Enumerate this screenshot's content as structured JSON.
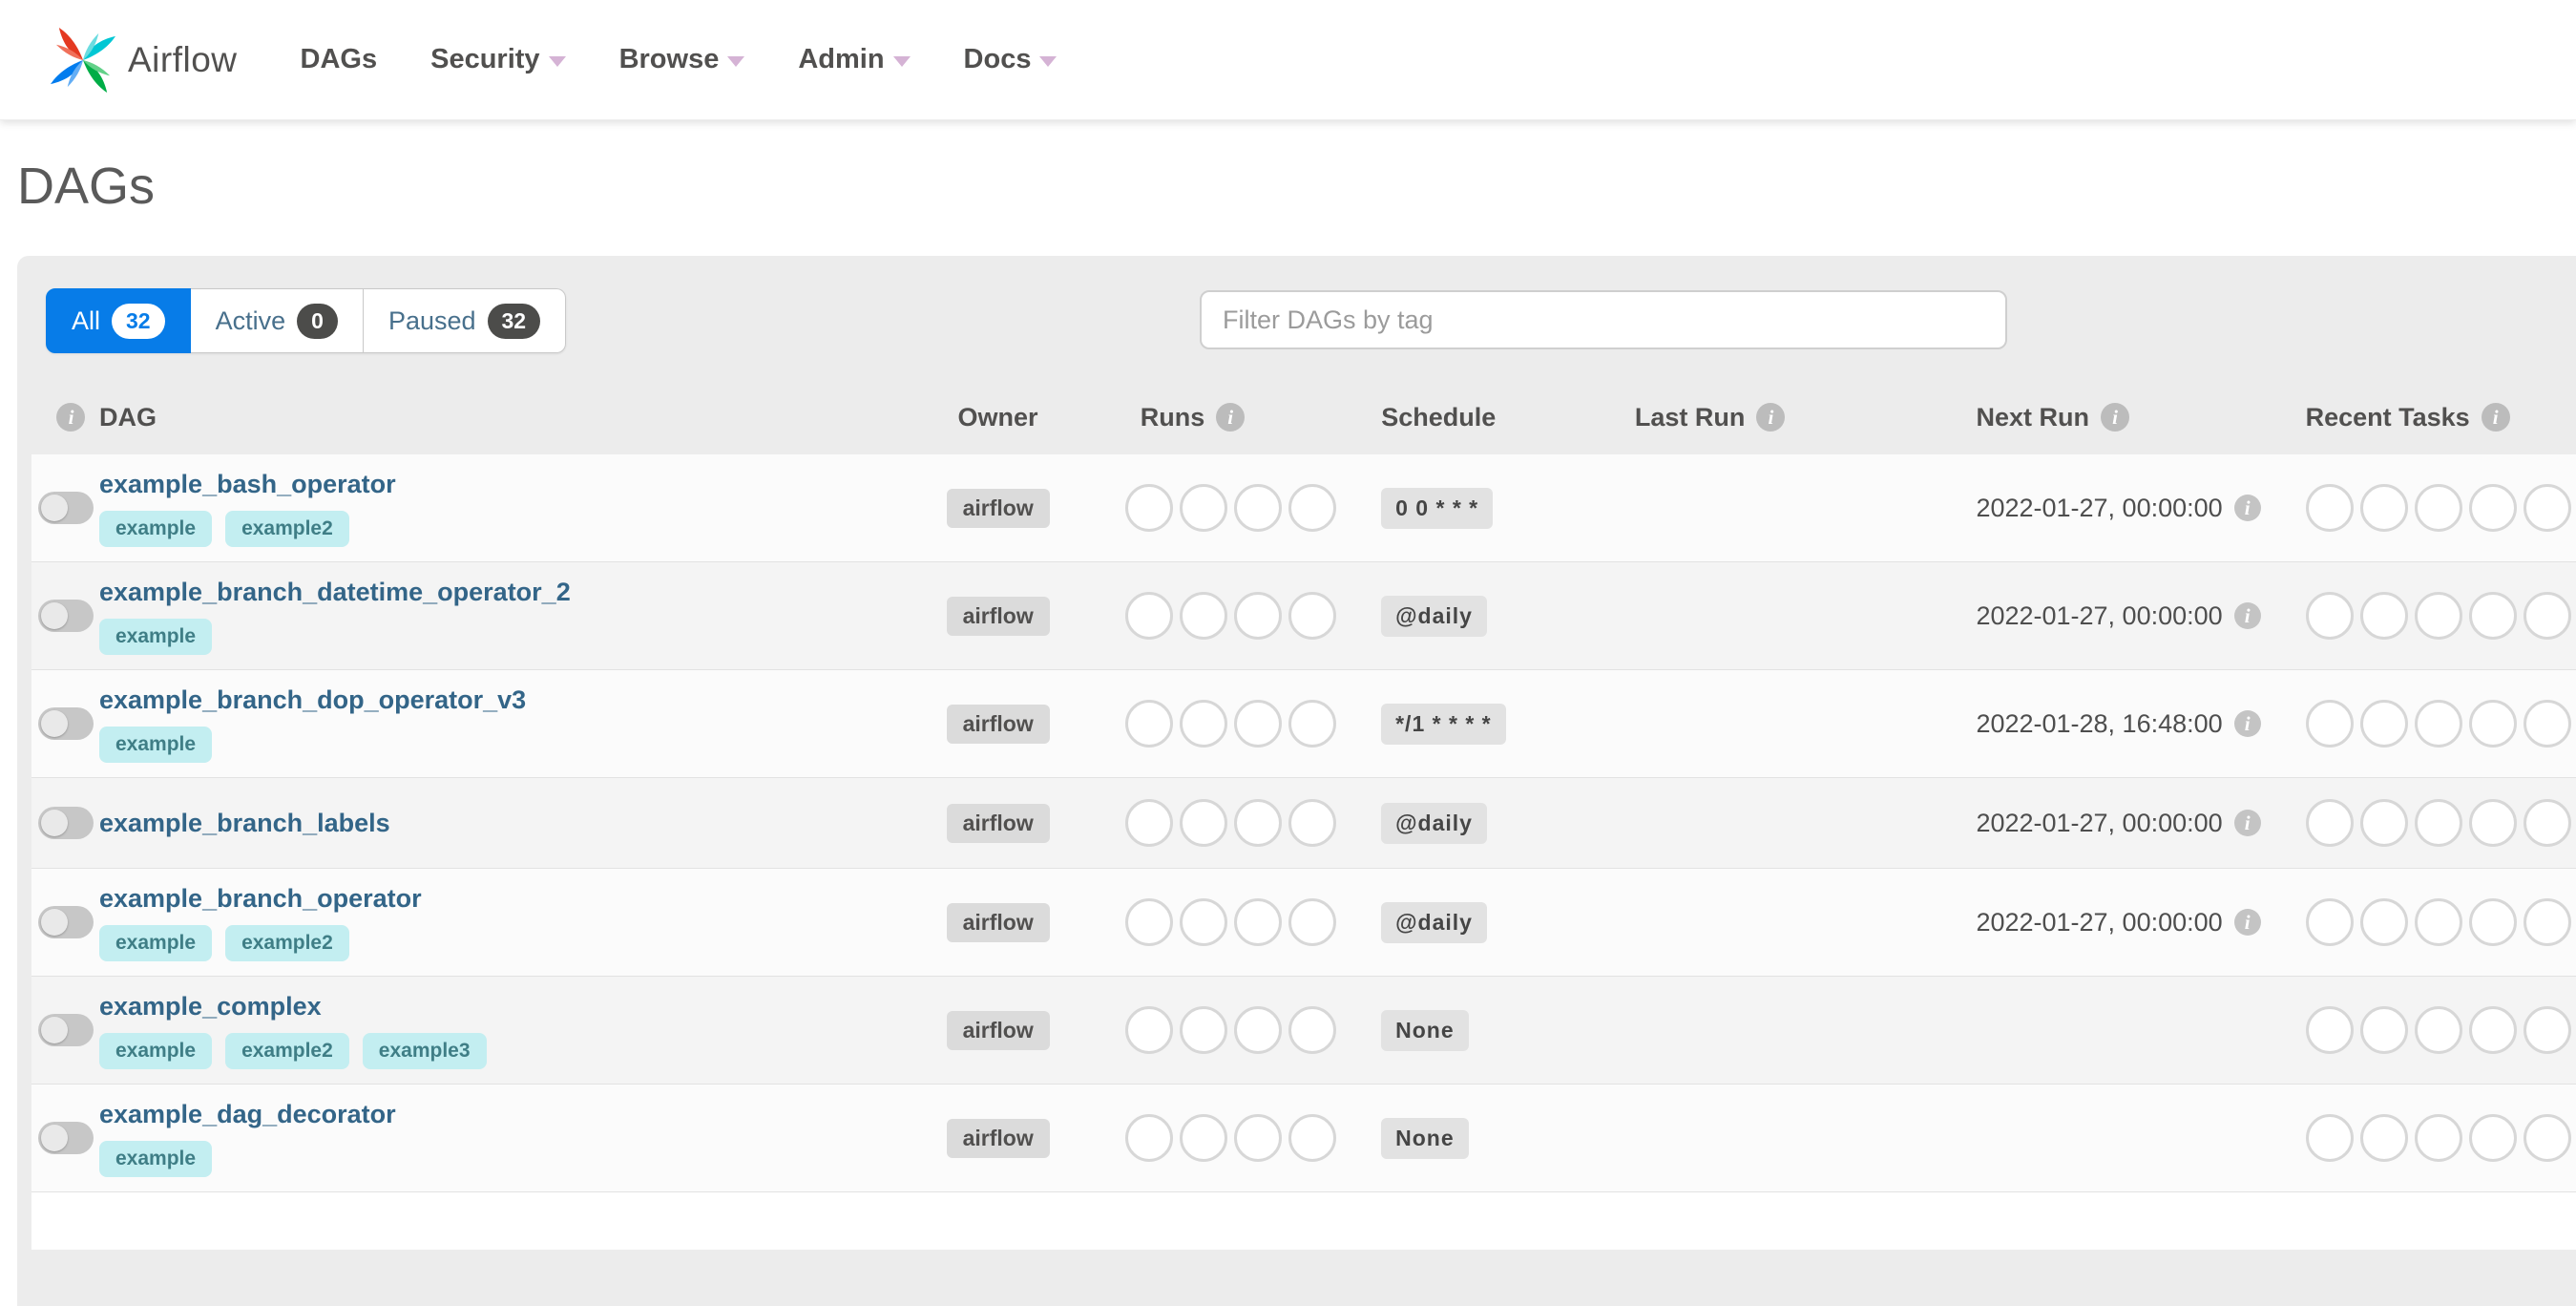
{
  "navbar": {
    "brand": "Airflow",
    "items": [
      {
        "label": "DAGs",
        "caret": false
      },
      {
        "label": "Security",
        "caret": true
      },
      {
        "label": "Browse",
        "caret": true
      },
      {
        "label": "Admin",
        "caret": true
      },
      {
        "label": "Docs",
        "caret": true
      }
    ]
  },
  "page_title": "DAGs",
  "controls": {
    "tabs": [
      {
        "label": "All",
        "count": "32",
        "active": true
      },
      {
        "label": "Active",
        "count": "0",
        "active": false
      },
      {
        "label": "Paused",
        "count": "32",
        "active": false
      }
    ],
    "filter_placeholder": "Filter DAGs by tag"
  },
  "table": {
    "headers": {
      "dag": "DAG",
      "owner": "Owner",
      "runs": "Runs",
      "schedule": "Schedule",
      "last_run": "Last Run",
      "next_run": "Next Run",
      "recent_tasks": "Recent Tasks"
    },
    "runs_slots": 4,
    "recent_tasks_slots": 5,
    "rows": [
      {
        "name": "example_bash_operator",
        "tags": [
          "example",
          "example2"
        ],
        "owner": "airflow",
        "schedule": "0 0 * * *",
        "last_run": "",
        "next_run": "2022-01-27, 00:00:00",
        "paused": true
      },
      {
        "name": "example_branch_datetime_operator_2",
        "tags": [
          "example"
        ],
        "owner": "airflow",
        "schedule": "@daily",
        "last_run": "",
        "next_run": "2022-01-27, 00:00:00",
        "paused": true
      },
      {
        "name": "example_branch_dop_operator_v3",
        "tags": [
          "example"
        ],
        "owner": "airflow",
        "schedule": "*/1 * * * *",
        "last_run": "",
        "next_run": "2022-01-28, 16:48:00",
        "paused": true
      },
      {
        "name": "example_branch_labels",
        "tags": [],
        "owner": "airflow",
        "schedule": "@daily",
        "last_run": "",
        "next_run": "2022-01-27, 00:00:00",
        "paused": true
      },
      {
        "name": "example_branch_operator",
        "tags": [
          "example",
          "example2"
        ],
        "owner": "airflow",
        "schedule": "@daily",
        "last_run": "",
        "next_run": "2022-01-27, 00:00:00",
        "paused": true
      },
      {
        "name": "example_complex",
        "tags": [
          "example",
          "example2",
          "example3"
        ],
        "owner": "airflow",
        "schedule": "None",
        "last_run": "",
        "next_run": "",
        "paused": true
      },
      {
        "name": "example_dag_decorator",
        "tags": [
          "example"
        ],
        "owner": "airflow",
        "schedule": "None",
        "last_run": "",
        "next_run": "",
        "paused": true
      }
    ]
  },
  "icons": {
    "info": "i"
  },
  "colors": {
    "accent_blue": "#077ce8",
    "brand_text": "#51504f",
    "dag_link": "#336588",
    "tag_bg": "#c3eef1",
    "tag_text": "#3f7e86",
    "owner_badge_bg": "#dbdbdb",
    "schedule_badge_bg": "#e2e2e2",
    "panel_bg": "#ececec",
    "logo_red": "#e43921",
    "logo_teal": "#00c7d4",
    "logo_green": "#00ad46",
    "logo_blue": "#017cee",
    "caret": "#d5b3d5"
  }
}
